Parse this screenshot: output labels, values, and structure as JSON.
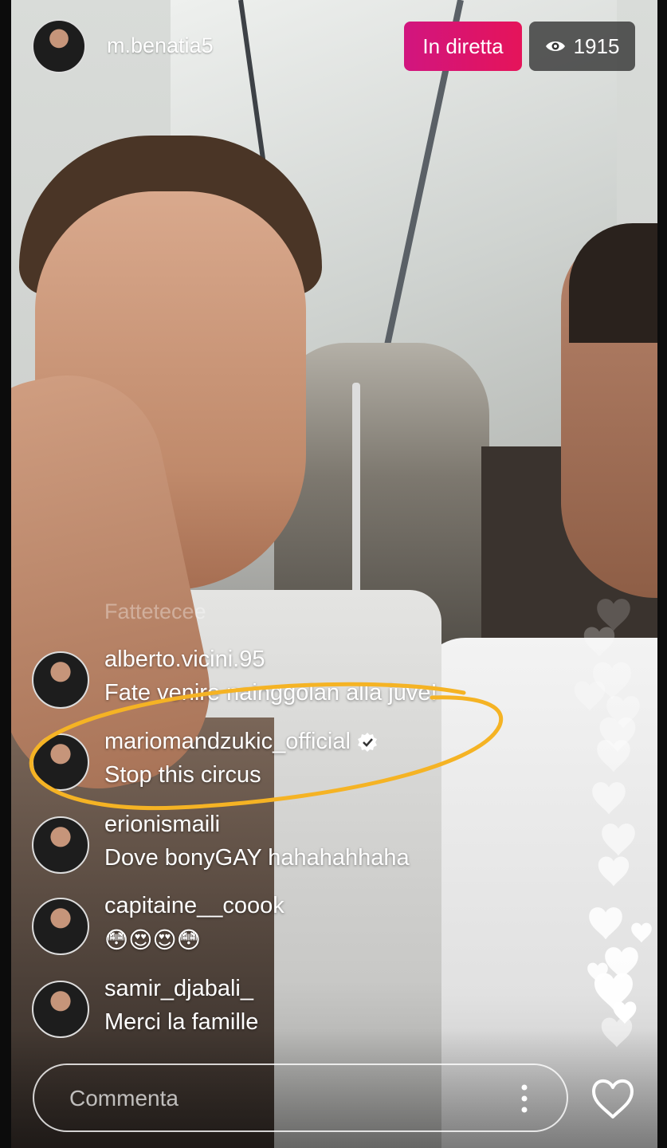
{
  "host": {
    "username": "m.benatia5",
    "avatar_icon": "profile-avatar"
  },
  "live": {
    "badge_label": "In diretta",
    "badge_color": "#dc1470",
    "viewer_icon": "eye-icon",
    "viewer_count": "1915"
  },
  "faded_comment": "Fattetecee",
  "comments": [
    {
      "username": "alberto.vicini.95",
      "text": "Fate venire nainggolan alla juve!",
      "verified": false
    },
    {
      "username": "mariomandzukic_official",
      "text": "Stop this circus",
      "verified": true
    },
    {
      "username": "erionismaili",
      "text": "Dove bonyGAY hahahahhaha",
      "verified": false
    },
    {
      "username": "capitaine__coook",
      "text": "😳😍😍😳",
      "verified": false
    },
    {
      "username": "samir_djabali_",
      "text": "Merci la famille",
      "verified": false
    }
  ],
  "highlight_color": "#f5b324",
  "input": {
    "placeholder": "Commenta",
    "more_icon": "more-vertical-icon"
  },
  "like_icon": "heart-icon"
}
